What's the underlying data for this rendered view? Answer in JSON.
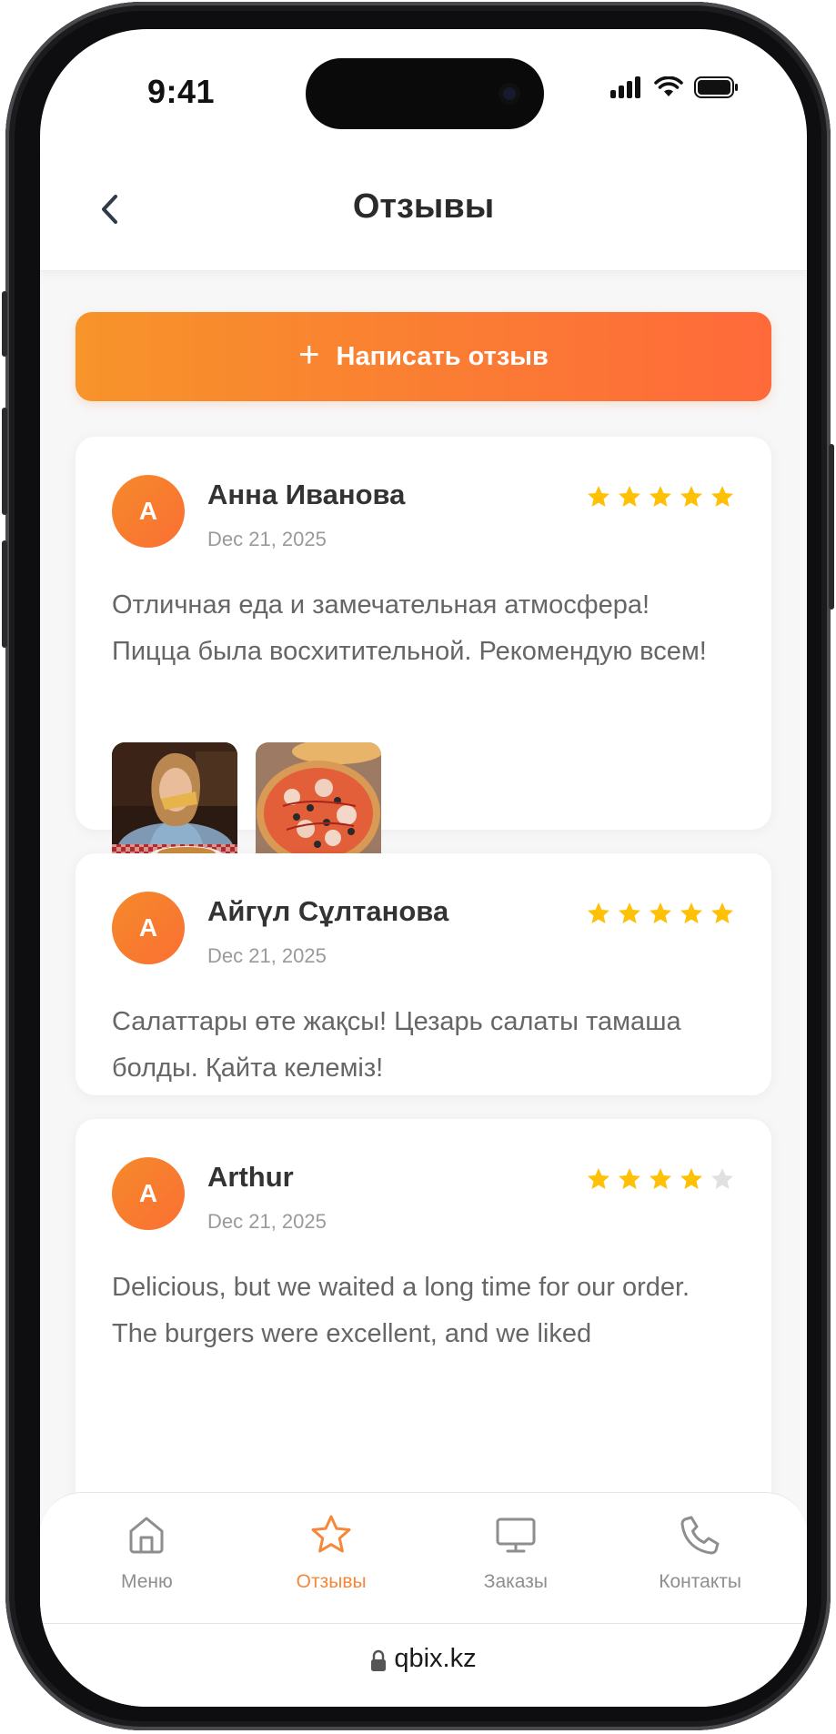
{
  "status_bar": {
    "time": "9:41"
  },
  "header": {
    "title": "Отзывы"
  },
  "actions": {
    "write_review_label": "Написать отзыв"
  },
  "reviews": [
    {
      "avatar_letter": "А",
      "name": "Анна Иванова",
      "date": "Dec 21, 2025",
      "rating": 5,
      "text": "Отличная еда и замечательная атмосфера! Пицца была восхитительной. Рекомендую всем!",
      "photos": [
        "woman-eating-pizza-photo",
        "pizza-photo"
      ]
    },
    {
      "avatar_letter": "А",
      "name": "Айгүл Сұлтанова",
      "date": "Dec 21, 2025",
      "rating": 5,
      "text": "Салаттары өте жақсы! Цезарь салаты тамаша болды. Қайта келеміз!"
    },
    {
      "avatar_letter": "A",
      "name": "Arthur",
      "date": "Dec 21, 2025",
      "rating": 4,
      "text": "Delicious, but we waited a long time for our order. The burgers were excellent, and we liked"
    }
  ],
  "bottom_nav": [
    {
      "label": "Меню",
      "icon": "home-icon",
      "active": false
    },
    {
      "label": "Отзывы",
      "icon": "star-icon",
      "active": true
    },
    {
      "label": "Заказы",
      "icon": "monitor-icon",
      "active": false
    },
    {
      "label": "Контакты",
      "icon": "phone-icon",
      "active": false
    }
  ],
  "browser": {
    "url": "qbix.kz"
  },
  "colors": {
    "accent": "#F5883A",
    "star": "#FFC107",
    "star_empty": "#E0E0E0"
  }
}
